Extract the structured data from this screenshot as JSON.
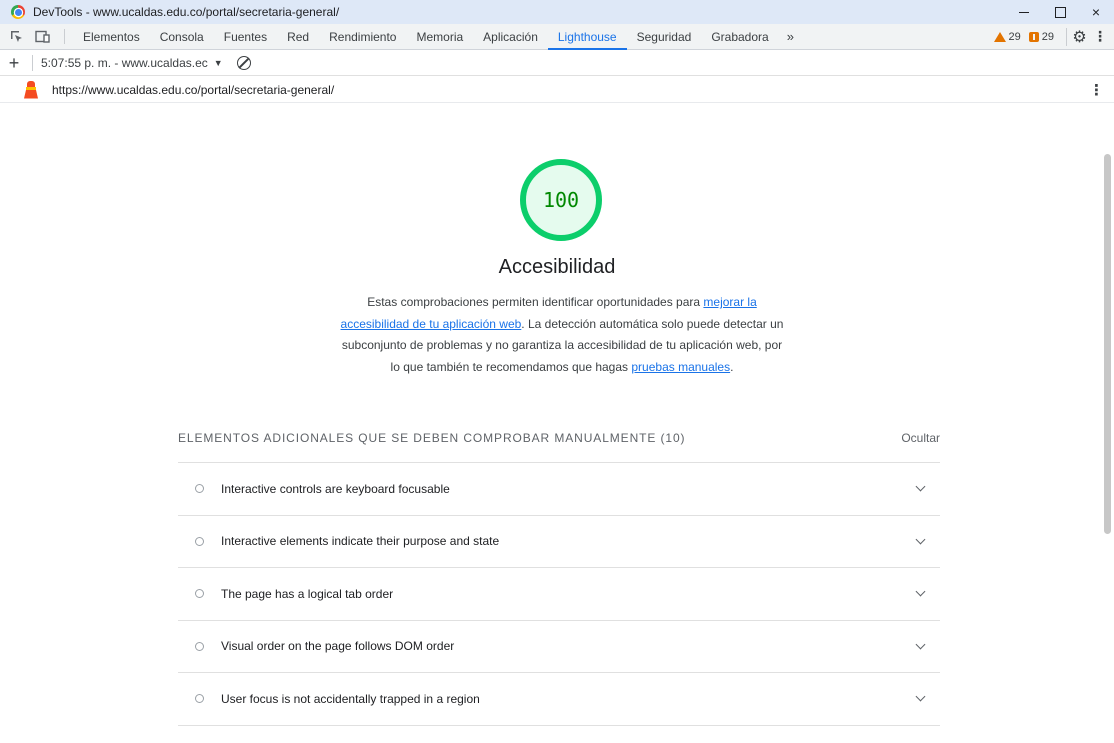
{
  "window": {
    "title": "DevTools - www.ucaldas.edu.co/portal/secretaria-general/",
    "close_glyph": "×"
  },
  "tabbar": {
    "tabs": [
      {
        "label": "Elementos"
      },
      {
        "label": "Consola"
      },
      {
        "label": "Fuentes"
      },
      {
        "label": "Red"
      },
      {
        "label": "Rendimiento"
      },
      {
        "label": "Memoria"
      },
      {
        "label": "Aplicación"
      },
      {
        "label": "Lighthouse",
        "active": true
      },
      {
        "label": "Seguridad"
      },
      {
        "label": "Grabadora"
      }
    ],
    "more_glyph": "»",
    "warnings_count": "29",
    "issues_count": "29",
    "icons": [
      "inspect-icon",
      "device-toggle-icon",
      "warning-icon",
      "issues-icon",
      "gear-icon",
      "kebab-icon"
    ],
    "warning_color": "#e37400",
    "active_color": "#1a73e8"
  },
  "report_toolbar": {
    "new_report_glyph": "+",
    "selected_report": "5:07:55 p. m. - www.ucaldas.ec",
    "caret_glyph": "▼"
  },
  "url_bar": {
    "url": "https://www.ucaldas.edu.co/portal/secretaria-general/"
  },
  "category": {
    "score": "100",
    "score_value": 100,
    "score_color": "#0cce6b",
    "title": "Accesibilidad",
    "desc_part1": "Estas comprobaciones permiten identificar oportunidades para ",
    "desc_link1": "mejorar la accesibilidad de tu aplicación web",
    "desc_part2": ". La detección automática solo puede detectar un subconjunto de problemas y no garantiza la accesibilidad de tu aplicación web, por lo que también te recomendamos que hagas ",
    "desc_link2": "pruebas manuales",
    "desc_part3": "."
  },
  "manual_section": {
    "title": "ELEMENTOS ADICIONALES QUE SE DEBEN COMPROBAR MANUALMENTE (10)",
    "toggle_label": "Ocultar",
    "audits": [
      {
        "title": "Interactive controls are keyboard focusable"
      },
      {
        "title": "Interactive elements indicate their purpose and state"
      },
      {
        "title": "The page has a logical tab order"
      },
      {
        "title": "Visual order on the page follows DOM order"
      },
      {
        "title": "User focus is not accidentally trapped in a region"
      }
    ]
  }
}
